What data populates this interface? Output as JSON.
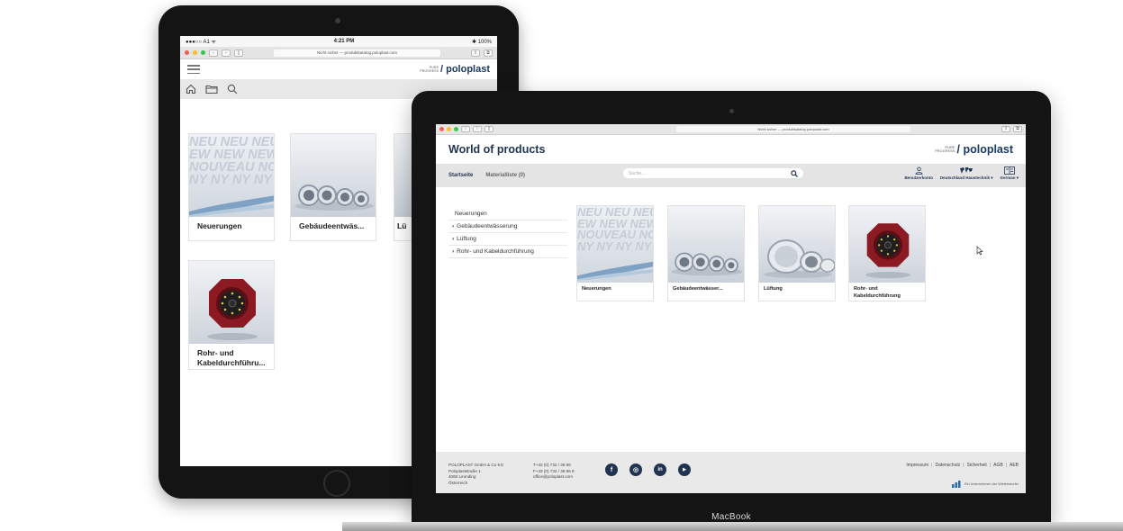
{
  "tablet": {
    "status": {
      "carrier": "●●●○○ A1 ᯤ",
      "time": "4:21 PM",
      "battery": "✱ 100%"
    },
    "url": "Nicht sicher — produktkatalog.poloplast.com",
    "logo": {
      "tagline_1": "PURE",
      "tagline_2": "PROGRESS",
      "name": "/ poloplast"
    },
    "cards": [
      {
        "label": "Neuerungen",
        "image": "new-text-image"
      },
      {
        "label": "Gebäudeentwäs...",
        "image": "pipes-image"
      },
      {
        "label": "Lü",
        "image": "grey-image"
      },
      {
        "label": "Rohr- und Kabeldurchführu...",
        "image": "red-fitting-image"
      }
    ],
    "new_text_rows": [
      "NEU NEU NEU",
      "EW NEW NEW",
      "NOUVEAU NO",
      "NY NY NY NY"
    ]
  },
  "laptop": {
    "url": "Nicht sicher — produktkatalog.poloplast.com",
    "title": "World of products",
    "logo": {
      "tagline_1": "PURE",
      "tagline_2": "PROGRESS",
      "name": "/ poloplast"
    },
    "nav": {
      "home": "Startseite",
      "materials": "Materialliste (0)"
    },
    "search": {
      "placeholder": "Suche..."
    },
    "tools": {
      "account": "Benutzerkonto",
      "region": "Deutschland Haustechnik ▾",
      "language": "German ▾"
    },
    "sidebar": [
      {
        "label": "Neuerungen",
        "arrow": ""
      },
      {
        "label": "Gebäudeentwässerung",
        "arrow": "›"
      },
      {
        "label": "Lüftung",
        "arrow": "›"
      },
      {
        "label": "Rohr- und Kabeldurchführung",
        "arrow": "›"
      }
    ],
    "cards": [
      {
        "label": "Neuerungen",
        "image": "new-text-image"
      },
      {
        "label": "Gebäudeentwässer...",
        "image": "pipes-image"
      },
      {
        "label": "Lüftung",
        "image": "ducts-image"
      },
      {
        "label": "Rohr- und Kabeldurchführung",
        "image": "red-fitting-image"
      }
    ],
    "footer": {
      "address": [
        "POLOPLAST GmbH & Co KG",
        "Poloplaststraße 1",
        "4060 Leonding",
        "Österreich"
      ],
      "contact": [
        "T+43 (0) 732 / 38 86",
        "F+43 (0) 732 / 38 86 9",
        "office@poloplast.com"
      ],
      "social": [
        "f",
        "◎",
        "in",
        "▶"
      ],
      "links": [
        "Impressum",
        "Datenschutz",
        "Sicherheit",
        "AGB",
        "AEB"
      ],
      "brand_text": "Ein Unternehmen der Wietersdorfer"
    },
    "brand_strip": "MacBook"
  },
  "colors": {
    "navy": "#1f3350",
    "footer_bg": "#e9e9e9",
    "red_product": "#8b1a22"
  }
}
